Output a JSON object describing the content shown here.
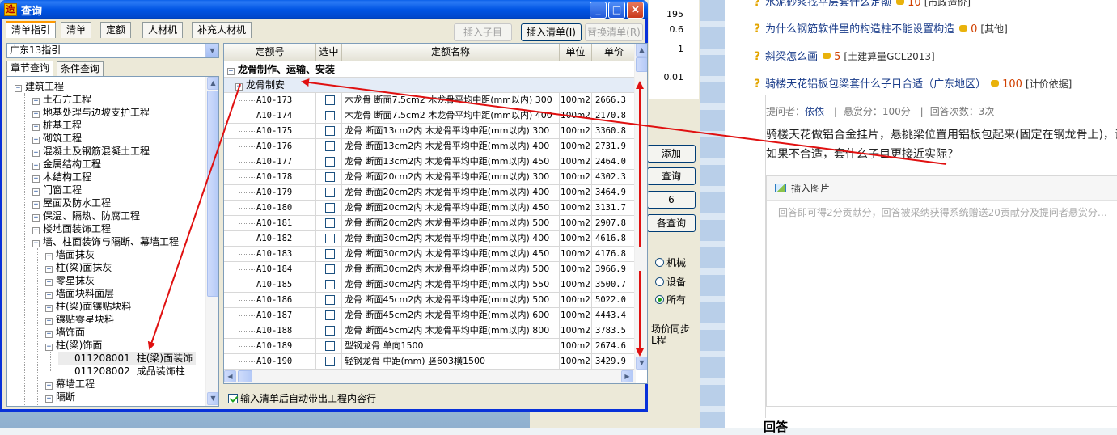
{
  "dialog": {
    "title": "查询",
    "app_icon_glyph": "造",
    "window_buttons": [
      "_",
      "□",
      "×"
    ],
    "tabs": [
      "清单指引",
      "清单",
      "定额",
      "人材机",
      "补充人材机"
    ],
    "active_tab": "清单指引",
    "toolbar": {
      "insert_child": "插入子目",
      "insert_list": "插入清单(I)",
      "replace_list": "替换清单(R)"
    },
    "combo_value": "广东13指引",
    "subtabs": [
      "章节查询",
      "条件查询"
    ],
    "active_subtab": "章节查询",
    "auto_check_label": "输入清单后自动带出工程内容行"
  },
  "tree": [
    "建筑工程",
    "土石方工程",
    "地基处理与边坡支护工程",
    "桩基工程",
    "砌筑工程",
    "混凝土及钢筋混凝土工程",
    "金属结构工程",
    "木结构工程",
    "门窗工程",
    "屋面及防水工程",
    "保温、隔热、防腐工程",
    "楼地面装饰工程",
    "墙、柱面装饰与隔断、幕墙工程",
    "墙面抹灰",
    "柱(梁)面抹灰",
    "零星抹灰",
    "墙面块料面层",
    "柱(梁)面镶贴块料",
    "镶贴零星块料",
    "墙饰面",
    "柱(梁)饰面",
    "011208001",
    "柱(梁)面装饰",
    "011208002",
    "成品装饰柱",
    "幕墙工程",
    "隔断"
  ],
  "grid": {
    "headers": [
      "定额号",
      "选中",
      "定额名称",
      "单位",
      "单价"
    ],
    "group1": "龙骨制作、运输、安装",
    "group2": "龙骨制安",
    "rows": [
      [
        "A10-173",
        "木龙骨 断面7.5cm2 木龙骨平均中距(mm以内) 300",
        "100m2",
        "2666.3"
      ],
      [
        "A10-174",
        "木龙骨 断面7.5cm2 木龙骨平均中距(mm以内) 400",
        "100m2",
        "2170.8"
      ],
      [
        "A10-175",
        "龙骨 断面13cm2内 木龙骨平均中距(mm以内) 300",
        "100m2",
        "3360.8"
      ],
      [
        "A10-176",
        "龙骨 断面13cm2内 木龙骨平均中距(mm以内) 400",
        "100m2",
        "2731.9"
      ],
      [
        "A10-177",
        "龙骨 断面13cm2内 木龙骨平均中距(mm以内) 450",
        "100m2",
        "2464.0"
      ],
      [
        "A10-178",
        "龙骨 断面20cm2内 木龙骨平均中距(mm以内) 300",
        "100m2",
        "4302.3"
      ],
      [
        "A10-179",
        "龙骨 断面20cm2内 木龙骨平均中距(mm以内) 400",
        "100m2",
        "3464.9"
      ],
      [
        "A10-180",
        "龙骨 断面20cm2内 木龙骨平均中距(mm以内) 450",
        "100m2",
        "3131.7"
      ],
      [
        "A10-181",
        "龙骨 断面20cm2内 木龙骨平均中距(mm以内) 500",
        "100m2",
        "2907.8"
      ],
      [
        "A10-182",
        "龙骨 断面30cm2内 木龙骨平均中距(mm以内) 400",
        "100m2",
        "4616.8"
      ],
      [
        "A10-183",
        "龙骨 断面30cm2内 木龙骨平均中距(mm以内) 450",
        "100m2",
        "4176.8"
      ],
      [
        "A10-184",
        "龙骨 断面30cm2内 木龙骨平均中距(mm以内) 500",
        "100m2",
        "3966.9"
      ],
      [
        "A10-185",
        "龙骨 断面30cm2内 木龙骨平均中距(mm以内) 550",
        "100m2",
        "3500.7"
      ],
      [
        "A10-186",
        "龙骨 断面45cm2内 木龙骨平均中距(mm以内) 500",
        "100m2",
        "5022.0"
      ],
      [
        "A10-187",
        "龙骨 断面45cm2内 木龙骨平均中距(mm以内) 600",
        "100m2",
        "4443.4"
      ],
      [
        "A10-188",
        "龙骨 断面45cm2内 木龙骨平均中距(mm以内) 800",
        "100m2",
        "3783.5"
      ],
      [
        "A10-189",
        "型钢龙骨 单向1500",
        "100m2",
        "2674.6"
      ],
      [
        "A10-190",
        "轻钢龙骨 中距(mm) 竖603横1500",
        "100m2",
        "3429.9"
      ]
    ]
  },
  "behind": {
    "values": [
      "195",
      "0.6",
      "1",
      "0.01"
    ],
    "buttons": [
      "添加",
      "查询",
      "6",
      "各查询"
    ],
    "radios": [
      "机械",
      "设备",
      "所有"
    ],
    "radio_selected": "所有",
    "sync_text": [
      "场价同步",
      "L程"
    ]
  },
  "web": {
    "questions": [
      {
        "title": "水泥砂浆找平层套什么定额",
        "points": "10",
        "tag": "[市政造价]"
      },
      {
        "title": "为什么钢筋软件里的构造柱不能设置构造",
        "points": "0",
        "tag": "[其他]"
      },
      {
        "title": "斜梁怎么画",
        "points": "5",
        "tag": "[土建算量GCL2013]"
      },
      {
        "title": "骑楼天花铝板包梁套什么子目合适（广东地区）",
        "points": "100",
        "tag": "[计价依据]"
      }
    ],
    "meta": {
      "asker_label": "提问者：",
      "asker": "依依",
      "reward": "悬赏分：100分",
      "answers": "回答次数：3次"
    },
    "body_lines": [
      "骑楼天花做铝合金挂片，悬挑梁位置用铝板包起来(固定在钢龙骨上)，请",
      "如果不合适，套什么子目更接近实际？"
    ],
    "insert_image": "插入图片",
    "placeholder": "回答即可得2分贡献分，回答被采纳获得系统赠送20贡献分及提问者悬赏分…",
    "answer_heading": "回答"
  },
  "colors": {
    "arrow": "#e01010",
    "titlebar": "#0054e3",
    "link": "#1a3c8a",
    "points": "#d04000"
  }
}
